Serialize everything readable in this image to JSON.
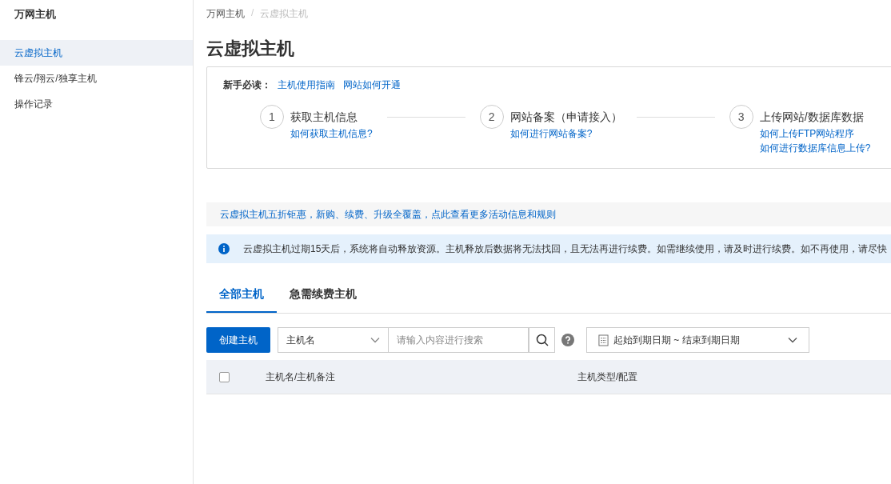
{
  "sidebar": {
    "title": "万网主机",
    "items": [
      {
        "label": "云虚拟主机",
        "selected": true
      },
      {
        "label": "锋云/翔云/独享主机",
        "selected": false
      },
      {
        "label": "操作记录",
        "selected": false
      }
    ]
  },
  "breadcrumb": {
    "separator": "/",
    "items": [
      "万网主机",
      "云虚拟主机"
    ]
  },
  "page_title": "云虚拟主机",
  "guide": {
    "label": "新手必读：",
    "links": [
      "主机使用指南",
      "网站如何开通"
    ],
    "steps": [
      {
        "number": "1",
        "title": "获取主机信息",
        "links": [
          "如何获取主机信息?"
        ]
      },
      {
        "number": "2",
        "title": "网站备案（申请接入）",
        "links": [
          "如何进行网站备案?"
        ]
      },
      {
        "number": "3",
        "title": "上传网站/数据库数据",
        "links": [
          "如何上传FTP网站程序",
          "如何进行数据库信息上传?"
        ]
      }
    ]
  },
  "promo": "云虚拟主机五折钜惠，新购、续费、升级全覆盖，点此查看更多活动信息和规则",
  "notice": "云虚拟主机过期15天后，系统将自动释放资源。主机释放后数据将无法找回，且无法再进行续费。如需继续使用，请及时进行续费。如不再使用，请尽快",
  "tabs": [
    {
      "label": "全部主机",
      "selected": true
    },
    {
      "label": "急需续费主机",
      "selected": false
    }
  ],
  "toolbar": {
    "create": "创建主机",
    "filter": "主机名",
    "search_placeholder": "请输入内容进行搜索",
    "date_range": "起始到期日期 ~ 结束到期日期"
  },
  "table": {
    "select_all": {
      "checked": false
    },
    "columns": [
      "主机名/主机备注",
      "主机类型/配置"
    ]
  }
}
